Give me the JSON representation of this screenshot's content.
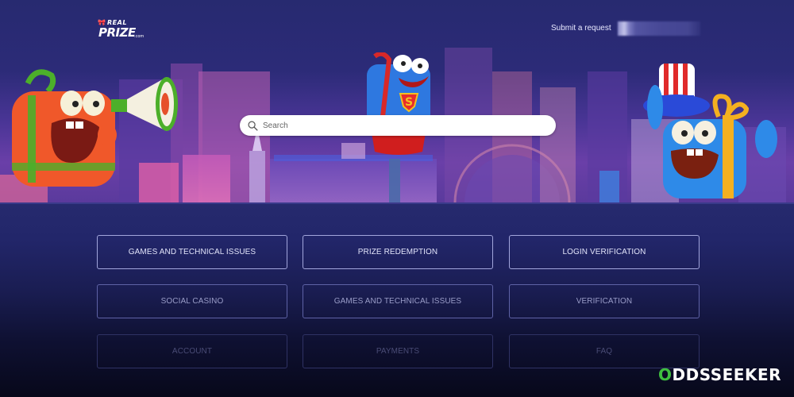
{
  "header": {
    "logo": {
      "top": "REAL",
      "main": "PRIZE",
      "suffix": ".com"
    },
    "submit_request_label": "Submit a request",
    "user_name_redacted": ""
  },
  "hero": {
    "search": {
      "placeholder": "Search",
      "value": ""
    },
    "characters": [
      "orange-gift-megaphone-mascot",
      "blue-superhero-gift-mascot",
      "blue-uncle-sam-gift-mascot"
    ]
  },
  "categories": [
    {
      "label": "GAMES AND TECHNICAL ISSUES"
    },
    {
      "label": "PRIZE REDEMPTION"
    },
    {
      "label": "LOGIN VERIFICATION"
    },
    {
      "label": "SOCIAL CASINO"
    },
    {
      "label": "GAMES AND TECHNICAL ISSUES"
    },
    {
      "label": "VERIFICATION"
    },
    {
      "label": "ACCOUNT"
    },
    {
      "label": "PAYMENTS"
    },
    {
      "label": "FAQ"
    }
  ],
  "watermark": {
    "first": "O",
    "rest": "DDSSEEKER"
  },
  "colors": {
    "background": "#272a6e",
    "watermark_accent": "#3fbf3f",
    "search_bg": "#ffffff"
  }
}
